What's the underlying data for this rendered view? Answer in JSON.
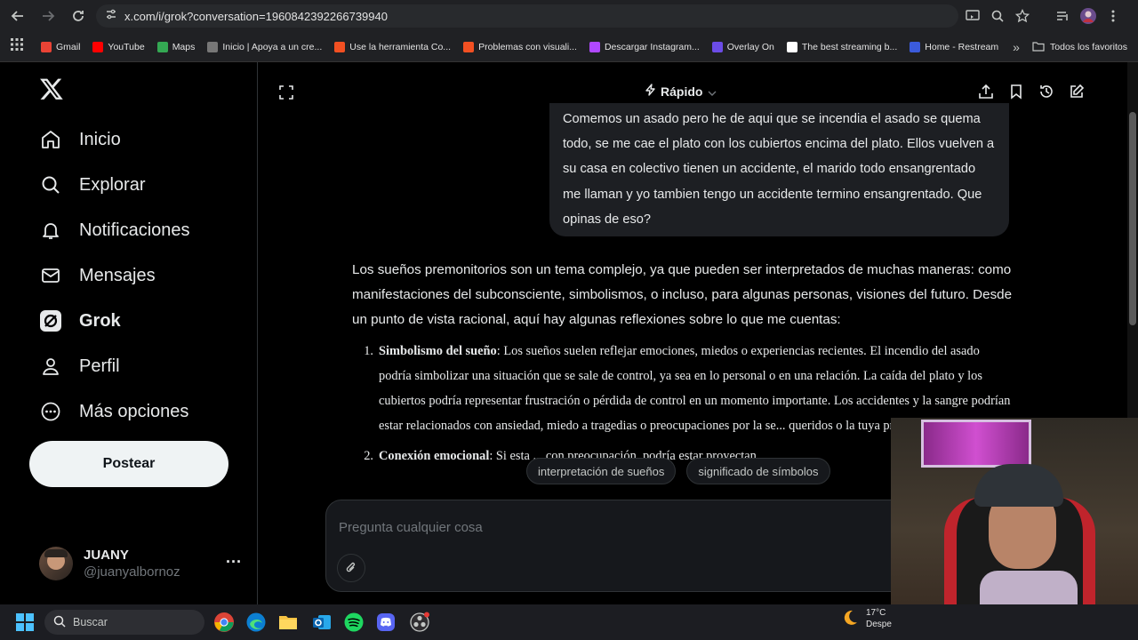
{
  "browser": {
    "url": "x.com/i/grok?conversation=1960842392266739940",
    "bookmarks": [
      {
        "label": "Gmail",
        "color": "#ea4335"
      },
      {
        "label": "YouTube",
        "color": "#ff0000"
      },
      {
        "label": "Maps",
        "color": "#34a853"
      },
      {
        "label": "Inicio | Apoya a un cre...",
        "color": "#777777"
      },
      {
        "label": "Use la herramienta Co...",
        "color": "#f25022"
      },
      {
        "label": "Problemas con visuali...",
        "color": "#f25022"
      },
      {
        "label": "Descargar Instagram...",
        "color": "#b048ff"
      },
      {
        "label": "Overlay On",
        "color": "#6b4ce6"
      },
      {
        "label": "The best streaming b...",
        "color": "#ffffff"
      },
      {
        "label": "Home - Restream",
        "color": "#3b5bdb"
      }
    ],
    "all_bookmarks": "Todos los favoritos"
  },
  "sidebar": {
    "items": [
      {
        "label": "Inicio",
        "icon": "home-icon"
      },
      {
        "label": "Explorar",
        "icon": "search-icon"
      },
      {
        "label": "Notificaciones",
        "icon": "bell-icon"
      },
      {
        "label": "Mensajes",
        "icon": "mail-icon"
      },
      {
        "label": "Grok",
        "icon": "grok-icon",
        "active": true
      },
      {
        "label": "Perfil",
        "icon": "person-icon"
      },
      {
        "label": "Más opciones",
        "icon": "more-circle-icon"
      }
    ],
    "post_label": "Postear",
    "user": {
      "name": "JUANY",
      "handle": "@juanyalbornoz"
    }
  },
  "chat": {
    "mode": "Rápido",
    "user_message": "Comemos un asado pero he de aqui que se incendia el asado se quema todo, se me cae el plato con los cubiertos encima del plato. Ellos vuelven a su casa en colectivo tienen un accidente, el marido todo ensangrentado me llaman y yo tambien tengo un accidente termino ensangrentado. Que opinas de eso?",
    "answer_intro": "Los sueños premonitorios son un tema complejo, ya que pueden ser interpretados de muchas maneras: como manifestaciones del subconsciente, simbolismos, o incluso, para algunas personas, visiones del futuro. Desde un punto de vista racional, aquí hay algunas reflexiones sobre lo que me cuentas:",
    "answer_items": [
      {
        "num": "1.",
        "title": "Simbolismo del sueño",
        "text": ": Los sueños suelen reflejar emociones, miedos o experiencias recientes. El incendio del asado podría simbolizar una situación que se sale de control, ya sea en lo personal o en una relación. La caída del plato y los cubiertos podría representar frustración o pérdida de control en un momento importante. Los accidentes y la sangre podrían estar relacionados con ansiedad, miedo a tragedias o preocupaciones por la se... queridos o la tuya propia."
      },
      {
        "num": "2.",
        "title": "Conexión emocional",
        "text": ": Si esta ... con preocupación, podría estar proyectan..."
      }
    ],
    "suggestions": [
      "interpretación de sueños",
      "significado de símbolos"
    ],
    "input_placeholder": "Pregunta cualquier cosa"
  },
  "taskbar": {
    "search_placeholder": "Buscar",
    "temperature": "17°C",
    "weather_text": "Despe"
  }
}
